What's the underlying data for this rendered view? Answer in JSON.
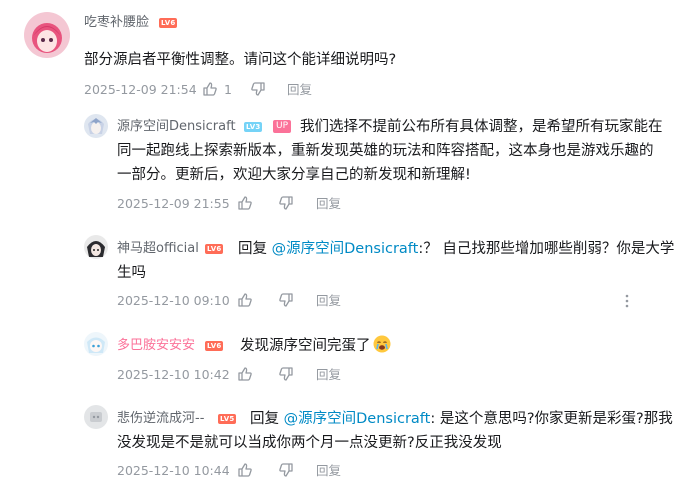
{
  "main_comment": {
    "username": "吃枣补腰脸",
    "level": "LV6",
    "text": "部分源启者平衡性调整。请问这个能详细说明吗?",
    "time": "2025-12-09 21:54",
    "likes": "1",
    "reply_label": "回复"
  },
  "replies": [
    {
      "username": "源序空间Densicraft",
      "level": "LV3",
      "up_badge": "UP",
      "line1": "我们选择不提前公布所有具体调整，是希望所有玩家能在",
      "line2": "同一起跑线上探索新版本，重新发现英雄的玩法和阵容搭配，这本身也是游戏乐趣的",
      "line3": "一部分。更新后，欢迎大家分享自己的新发现和新理解!",
      "time": "2025-12-09 21:55",
      "reply_label": "回复"
    },
    {
      "username": "神马超official",
      "level": "LV6",
      "reply_prefix": "回复",
      "mention": "@源序空间Densicraft",
      "line1_rest": ":？ 自己找那些增加哪些削弱？你是大学",
      "line2": "生吗",
      "time": "2025-12-10 09:10",
      "reply_label": "回复",
      "more_icon": "more-vertical-icon"
    },
    {
      "username": "多巴胺安安安",
      "level": "LV6",
      "text": "发现源序空间完蛋了",
      "emoji": "crying-face-emoji",
      "time": "2025-12-10 10:42",
      "reply_label": "回复"
    },
    {
      "username": "悲伤逆流成河--",
      "level": "LV5",
      "reply_prefix": "回复",
      "mention": "@源序空间Densicraft",
      "line1_rest": ": 是这个意思吗?你家更新是彩蛋?那我",
      "line2": "没发现是不是就可以当成你两个月一点没更新?反正我没发现",
      "time": "2025-12-10 10:44",
      "reply_label": "回复"
    }
  ],
  "colors": {
    "level_badge": "#ff6c57",
    "level_badge_low": "#75d3f7",
    "up_badge": "#fb7299",
    "mention": "#008ac5",
    "meta": "#9499a0",
    "vip_name": "#fb7299"
  }
}
